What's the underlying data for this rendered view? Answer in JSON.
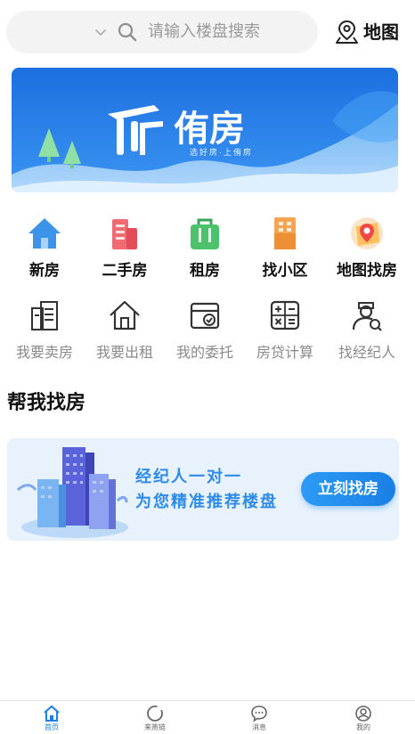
{
  "header": {
    "search": {
      "placeholder": "请输入楼盘搜索"
    },
    "map_label": "地图"
  },
  "banner": {
    "brand": "侑房",
    "slogan": "选好房·上侑房"
  },
  "main_nav": [
    {
      "label": "新房",
      "icon": "house-icon"
    },
    {
      "label": "二手房",
      "icon": "buildings-icon"
    },
    {
      "label": "租房",
      "icon": "shopping-bag-icon"
    },
    {
      "label": "找小区",
      "icon": "apartment-icon"
    },
    {
      "label": "地图找房",
      "icon": "map-pin-icon"
    }
  ],
  "secondary_nav": [
    {
      "label": "我要卖房",
      "icon": "building-list-icon"
    },
    {
      "label": "我要出租",
      "icon": "house-outline-icon"
    },
    {
      "label": "我的委托",
      "icon": "wallet-check-icon"
    },
    {
      "label": "房贷计算",
      "icon": "calculator-icon"
    },
    {
      "label": "找经纪人",
      "icon": "agent-search-icon"
    }
  ],
  "help_section": {
    "title": "帮我找房",
    "line1": "经纪人一对一",
    "line2": "为您精准推荐楼盘",
    "button": "立刻找房"
  },
  "tabbar": [
    {
      "label": "首页",
      "icon": "home-icon",
      "active": true
    },
    {
      "label": "来燕链",
      "icon": "circle-icon",
      "active": false
    },
    {
      "label": "消息",
      "icon": "chat-bubble-icon",
      "active": false
    },
    {
      "label": "我的",
      "icon": "user-icon",
      "active": false
    }
  ],
  "colors": {
    "accent": "#1b7fe6",
    "banner_blue": "#1f78e8",
    "search_bg": "#f3f3f3",
    "promo_bg": "#e7f2fd"
  }
}
